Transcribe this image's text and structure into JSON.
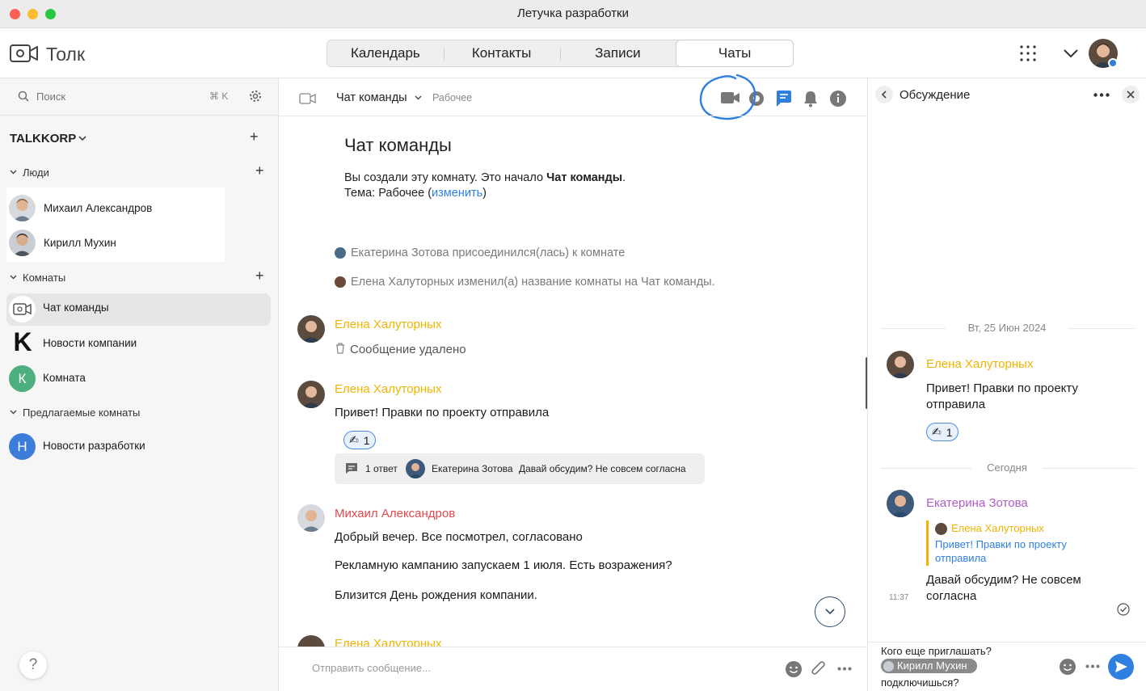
{
  "window": {
    "title": "Летучка разработки"
  },
  "app": {
    "name": "Толк"
  },
  "tabs": [
    {
      "label": "Календарь"
    },
    {
      "label": "Контакты"
    },
    {
      "label": "Записи"
    },
    {
      "label": "Чаты",
      "active": true
    }
  ],
  "sidebar": {
    "search_placeholder": "Поиск",
    "search_shortcut": "⌘ K",
    "workspace": "TALKKORP",
    "sections": {
      "people": "Люди",
      "rooms": "Комнаты",
      "suggested": "Предлагаемые комнаты"
    },
    "people": [
      {
        "name": "Михаил Александров"
      },
      {
        "name": "Кирилл Мухин"
      }
    ],
    "rooms": [
      {
        "name": "Чат команды",
        "selected": true
      },
      {
        "name": "Новости компании",
        "letter": "K"
      },
      {
        "name": "Комната",
        "letter": "К",
        "color": "#4caf7d"
      }
    ],
    "suggested_rooms": [
      {
        "name": "Новости разработки",
        "letter": "Н",
        "color": "#3b7dd8"
      }
    ],
    "help": "?"
  },
  "chat": {
    "title": "Чат команды",
    "topic": "Рабочее",
    "intro_title": "Чат команды",
    "intro_line1_prefix": "Вы создали эту комнату. Это начало ",
    "intro_line1_bold": "Чат команды",
    "intro_line1_suffix": ".",
    "intro_line2_prefix": "Тема: Рабочее (",
    "intro_line2_link": "изменить",
    "intro_line2_suffix": ")",
    "events": [
      "Екатерина Зотова присоединился(лась) к комнате",
      "Елена Халуторных изменил(а) название комнаты на Чат команды."
    ],
    "messages": [
      {
        "author": "Елена Халуторных",
        "text": "Сообщение удалено"
      },
      {
        "author": "Елена Халуторных",
        "text": "Привет! Правки по проекту отправила",
        "reaction": "✍",
        "reaction_count": "1",
        "thread": {
          "count": "1 ответ",
          "author": "Екатерина Зотова",
          "preview": "Давай обсудим? Не совсем согласна"
        }
      },
      {
        "author": "Михаил Александров",
        "lines": [
          "Добрый вечер. Все посмотрел, согласовано",
          "Рекламную кампанию запускаем 1 июля. Есть возражения?",
          "Близится День рождения компании."
        ]
      },
      {
        "author": "Елена Халуторных"
      }
    ],
    "composer_placeholder": "Отправить сообщение..."
  },
  "thread_panel": {
    "title": "Обсуждение",
    "date1": "Вт, 25 Июн 2024",
    "msg1": {
      "author": "Елена Халуторных",
      "text": "Привет! Правки по проекту отправила",
      "reaction": "✍",
      "reaction_count": "1"
    },
    "date2": "Сегодня",
    "msg2": {
      "author": "Екатерина Зотова",
      "quote_author": "Елена Халуторных",
      "quote_text": "Привет! Правки по проекту отправила",
      "text": "Давай обсудим? Не совсем согласна",
      "time": "11:37"
    },
    "composer": {
      "prefix": "Кого еще приглашать?",
      "mention": "Кирилл Мухин",
      "suffix": "подключишься?"
    }
  },
  "colors": {
    "accent": "#2f7fe0",
    "yellow_name": "#f0b400",
    "red_name": "#e5484d",
    "purple_name": "#b05ccb",
    "annotation": "#2f7fe0"
  }
}
